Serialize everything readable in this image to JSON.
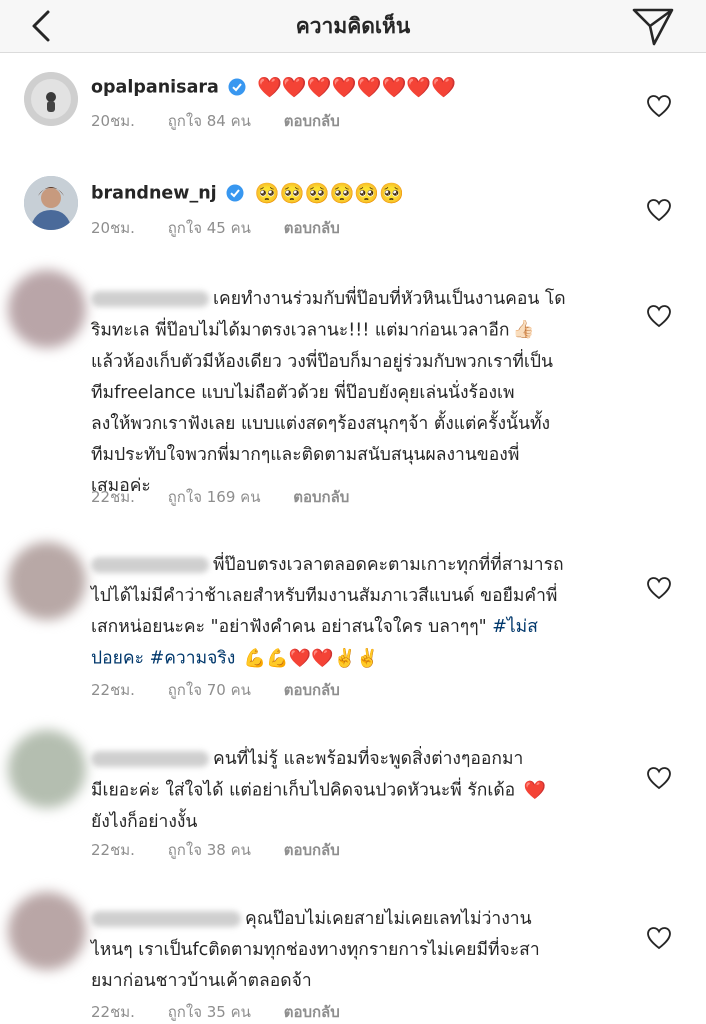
{
  "header": {
    "title": "ความคิดเห็น"
  },
  "colors": {
    "heart": "#ed1c3a",
    "verified": "#3897f0",
    "meta": "#8e8e8e",
    "hashtag": "#00376b"
  },
  "icons": {
    "back": "chevron-left-icon",
    "send": "paper-plane-icon",
    "like": "heart-outline-icon"
  },
  "comments": [
    {
      "username": "opalpanisara",
      "verified": true,
      "text": "",
      "emoji": "❤️❤️❤️❤️❤️❤️❤️❤️",
      "time": "20ชม.",
      "likes": "ถูกใจ 84 คน",
      "reply": "ตอบกลับ"
    },
    {
      "username": "brandnew_nj",
      "verified": true,
      "text": "",
      "emoji": "🥺🥺🥺🥺🥺🥺",
      "time": "20ชม.",
      "likes": "ถูกใจ 45 คน",
      "reply": "ตอบกลับ"
    },
    {
      "username": "",
      "verified": false,
      "lines": [
        "เคยทำงานร่วมกับพี่ป๊อบที่หัวหินเป็นงานคอน โด",
        "ริมทะเล พี่ป๊อบไม่ได้มาตรงเวลานะ!!! แต่มาก่อนเวลาอีก",
        "แล้วห้องเก็บตัวมีห้องเดียว วงพี่ป๊อบก็มาอยู่ร่วมกับพวกเราที่เป็น",
        "ทีมfreelance แบบไม่ถือตัวด้วย พี่ป๊อบยังคุยเล่นนั่งร้องเพ",
        "ลงให้พวกเราฟังเลย แบบแต่งสดๆร้องสนุกๆจ้า ตั้งแต่ครั้งนั้นทั้ง",
        "ทีมประทับใจพวกพี่มากๆและติดตามสนับสนุนผลงานของพี่",
        "เสมอค่ะ"
      ],
      "time": "22ชม.",
      "likes": "ถูกใจ 169 คน",
      "reply": "ตอบกลับ"
    },
    {
      "username": "",
      "verified": false,
      "lines": [
        "พี่ป๊อบตรงเวลาตลอดคะตามเกาะทุกที่ที่สามารถ",
        "ไปได้ไม่มีคำว่าช้าเลยสำหรับทีมงานสัมภาเวสีแบนด์ ขอยืมคำพี่",
        "เสกหน่อยนะคะ \"อย่าฟังคำคน อย่าสนใจใคร  บลาๆๆ\" "
      ],
      "hashtag1": "#ไม่ส",
      "hashtag1b": "ปอยคะ",
      "hashtag2": "#ความจริง",
      "time": "22ชม.",
      "likes": "ถูกใจ 70 คน",
      "reply": "ตอบกลับ"
    },
    {
      "username": "",
      "verified": false,
      "lines": [
        "คนที่ไม่รู้ และพร้อมที่จะพูดสิ่งต่างๆออกมา",
        "มีเยอะค่ะ ใส่ใจได้ แต่อย่าเก็บไปคิดจนปวดหัวนะพี่ รักเด้อ",
        "ยังไงก็อย่างงั้น"
      ],
      "time": "22ชม.",
      "likes": "ถูกใจ 38 คน",
      "reply": "ตอบกลับ"
    },
    {
      "username": "",
      "verified": false,
      "lines": [
        "คุณป๊อบไม่เคยสายไม่เคยเลทไม่ว่างาน",
        "ไหนๆ เราเป็นfcติดตามทุกช่องทางทุกรายการไม่เคยมีที่จะสา",
        "ยมาก่อนชาวบ้านเค้าตลอดจ้า"
      ],
      "time": "22ชม.",
      "likes": "ถูกใจ 35 คน",
      "reply": "ตอบกลับ"
    }
  ]
}
